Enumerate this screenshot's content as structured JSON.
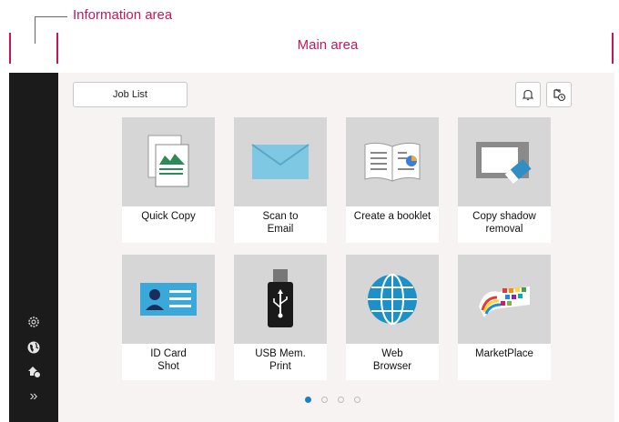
{
  "annotations": {
    "info_area": "Information area",
    "main_area": "Main area"
  },
  "header": {
    "job_list": "Job List",
    "notification_icon": "bell-icon",
    "status_icon": "job-status-icon"
  },
  "sidebar": {
    "items": [
      {
        "icon": "settings-icon"
      },
      {
        "icon": "globe-icon"
      },
      {
        "icon": "accessibility-icon"
      },
      {
        "icon": "expand-icon",
        "glyph": "»"
      }
    ]
  },
  "tiles": [
    {
      "label": "Quick Copy",
      "icon": "quick-copy-icon"
    },
    {
      "label": "Scan to\nEmail",
      "icon": "envelope-icon"
    },
    {
      "label": "Create a booklet",
      "icon": "booklet-icon"
    },
    {
      "label": "Copy shadow\nremoval",
      "icon": "eraser-icon"
    },
    {
      "label": "ID Card\nShot",
      "icon": "id-card-icon"
    },
    {
      "label": "USB Mem.\nPrint",
      "icon": "usb-icon"
    },
    {
      "label": "Web\nBrowser",
      "icon": "web-globe-icon"
    },
    {
      "label": "MarketPlace",
      "icon": "marketplace-icon"
    }
  ],
  "pagination": {
    "pages": 4,
    "current": 1
  },
  "colors": {
    "accent": "#1f7fc1",
    "annotation": "#c2185b",
    "sidebar": "#1b1b1b"
  }
}
